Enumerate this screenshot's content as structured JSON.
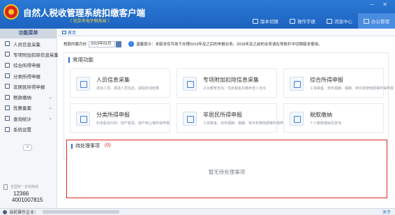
{
  "app": {
    "title": "自然人税收管理系统扣缴客户端",
    "subtitle": "（ 北京市电子税务局 ）",
    "window_controls": "─ ✕"
  },
  "toolbar": {
    "items": [
      {
        "label": "版本切换",
        "icon": "switch-icon"
      },
      {
        "label": "操作手册",
        "icon": "manual-icon"
      },
      {
        "label": "消息中心",
        "icon": "message-icon"
      },
      {
        "label": "办公管理",
        "icon": "office-icon"
      }
    ]
  },
  "sidebar": {
    "header": "功能菜单",
    "items": [
      {
        "label": "人员信息采集",
        "icon": "person-icon",
        "expandable": false
      },
      {
        "label": "专项附加扣除信息采集",
        "icon": "deduction-icon",
        "expandable": true
      },
      {
        "label": "综合所得申报",
        "icon": "report-icon",
        "expandable": false
      },
      {
        "label": "分类所得申报",
        "icon": "classify-icon",
        "expandable": false
      },
      {
        "label": "非居民所得申报",
        "icon": "nonresident-icon",
        "expandable": false
      },
      {
        "label": "税款缴纳",
        "icon": "tax-payment-icon",
        "expandable": true
      },
      {
        "label": "优惠备案",
        "icon": "preferential-icon",
        "expandable": true
      },
      {
        "label": "查询统计",
        "icon": "query-icon",
        "expandable": true
      },
      {
        "label": "系统设置",
        "icon": "settings-icon",
        "expandable": false
      }
    ],
    "collapse_label": "«",
    "hotline": {
      "label": "全国统一咨询热线",
      "number1": "12366",
      "number2": "4001007815"
    }
  },
  "main": {
    "home_tab": "首页",
    "period": {
      "label": "税款所属月份",
      "value": "2019年01月"
    },
    "notice": "温馨提示：本版本仅可用于办理2019年及之后的申报业务。2018年及之前的业务请在导航栏中切换版本使用。",
    "common": {
      "title": "常用功能",
      "cards": [
        {
          "title": "人员信息采集",
          "desc": "添加人员、报送人员信息、获取反馈结果"
        },
        {
          "title": "专项附加扣除信息采集",
          "desc": "子女教育支出、住房租金及赡养老人支出"
        },
        {
          "title": "综合所得申报",
          "desc": "工资薪金、劳务报酬、稿酬、特许权使用费等所得申报"
        },
        {
          "title": "分类所得申报",
          "desc": "利息股息红利、财产租赁、财产转让等所得申报"
        },
        {
          "title": "非居民所得申报",
          "desc": "工资薪金、劳务报酬、稿酬、特许权使用费等所得申报"
        },
        {
          "title": "税款缴纳",
          "desc": "个人税款缴纳及查询"
        }
      ]
    },
    "todo": {
      "title": "待处理事项",
      "count": "(0)",
      "empty": "暂无待处理事项"
    }
  },
  "statusbar": {
    "label": "当前操作企业：",
    "about": "关于"
  },
  "colors": {
    "titlebar": "#1d63c1",
    "accent": "#2a6fd1",
    "todo_border": "#e0271d"
  }
}
